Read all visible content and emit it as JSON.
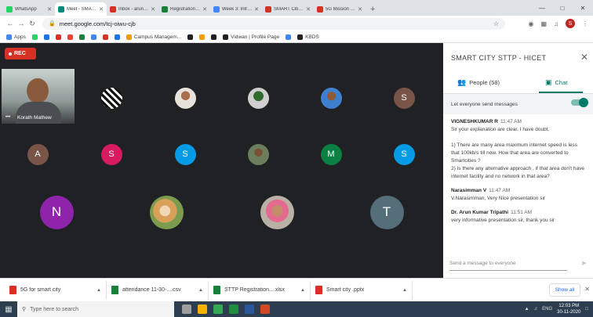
{
  "browser": {
    "tabs": [
      {
        "label": "WhatsApp",
        "color": "#25d366",
        "active": false
      },
      {
        "label": "Meet - SMART CITY",
        "color": "#00897b",
        "active": true
      },
      {
        "label": "Inbox - arunbtp",
        "color": "#d93025",
        "active": false
      },
      {
        "label": "Registration Confirm",
        "color": "#188038",
        "active": false
      },
      {
        "label": "Week 3: Introduction",
        "color": "#4285f4",
        "active": false
      },
      {
        "label": "SMART Cities Mission",
        "color": "#d93025",
        "active": false
      },
      {
        "label": "5G Mission 5G|US",
        "color": "#d93025",
        "active": false
      }
    ],
    "new_tab": "+",
    "url": "meet.google.com/tcj-oiwu-cjb",
    "profile_initial": "S"
  },
  "bookmarks": [
    {
      "label": "Apps",
      "color": "#4285f4"
    },
    {
      "label": "",
      "color": "#25d366"
    },
    {
      "label": "",
      "color": "#1a73e8"
    },
    {
      "label": "",
      "color": "#d93025"
    },
    {
      "label": "",
      "color": "#ea4335"
    },
    {
      "label": "",
      "color": "#188038"
    },
    {
      "label": "",
      "color": "#4285f4"
    },
    {
      "label": "",
      "color": "#d93025"
    },
    {
      "label": "",
      "color": "#1a73e8"
    },
    {
      "label": "Campus Managem...",
      "color": "#f29900"
    },
    {
      "label": "",
      "color": "#202124"
    },
    {
      "label": "",
      "color": "#ff9900"
    },
    {
      "label": "",
      "color": "#202124"
    },
    {
      "label": "Vidwan | Profile Page",
      "color": "#202124"
    },
    {
      "label": "",
      "color": "#4285f4"
    },
    {
      "label": "KBDS",
      "color": "#202124"
    }
  ],
  "meet": {
    "rec_label": "REC",
    "presenter_name": "Korath Mathew",
    "participants_row1": [
      {
        "letter": "",
        "style": "photo4"
      },
      {
        "letter": "",
        "style": "photo2"
      },
      {
        "letter": "",
        "style": "photo5"
      },
      {
        "letter": "",
        "style": "photo3"
      },
      {
        "letter": "S",
        "color": "#795548"
      }
    ],
    "participants_row2": [
      {
        "letter": "A",
        "color": "#795548"
      },
      {
        "letter": "S",
        "color": "#d81b60"
      },
      {
        "letter": "S",
        "color": "#039be5"
      },
      {
        "letter": "",
        "style": "photo6"
      },
      {
        "letter": "M",
        "color": "#0b8043"
      },
      {
        "letter": "S",
        "color": "#039be5"
      }
    ],
    "participants_row3": [
      {
        "letter": "N",
        "color": "#8e24aa"
      },
      {
        "letter": "",
        "style": "photo7"
      },
      {
        "letter": "",
        "style": "photo8"
      },
      {
        "letter": "T",
        "color": "#546e7a"
      }
    ]
  },
  "panel": {
    "title": "SMART CITY STTP - HICET",
    "people_label": "People (58)",
    "chat_label": "Chat",
    "let_everyone": "Let everyone send messages",
    "input_placeholder": "Send a message to everyone",
    "messages": [
      {
        "sender": "VIGNESHKUMAR R",
        "time": "11:47 AM",
        "text": "Sir your explanation are clear. I have doubt.\n\n1) There are many area maximum internet speed is less that 100kb/s till now. How that area are converted to Smartcities ?\n2) Is there any alternative approach , if that area don't have internet facility and no network in that area?"
      },
      {
        "sender": "Narasimman V",
        "time": "11:47 AM",
        "text": "V.Narasimman, Very Nice presentation sir"
      },
      {
        "sender": "Dr. Arun Kumar Tripathi",
        "time": "11:51 AM",
        "text": "very informative presentation sir,  thank you sir"
      }
    ]
  },
  "downloads": {
    "items": [
      {
        "label": "5G for smart city",
        "color": "#d93025"
      },
      {
        "label": "attendance 11-30-....csv",
        "color": "#188038"
      },
      {
        "label": "STTP Registration....xlsx",
        "color": "#188038"
      },
      {
        "label": "Smart city .pptx",
        "color": "#d93025"
      }
    ],
    "show_all": "Show all"
  },
  "taskbar": {
    "search_placeholder": "Type here to search",
    "lang": "ENG",
    "time": "12:03 PM",
    "date": "30-11-2020"
  }
}
